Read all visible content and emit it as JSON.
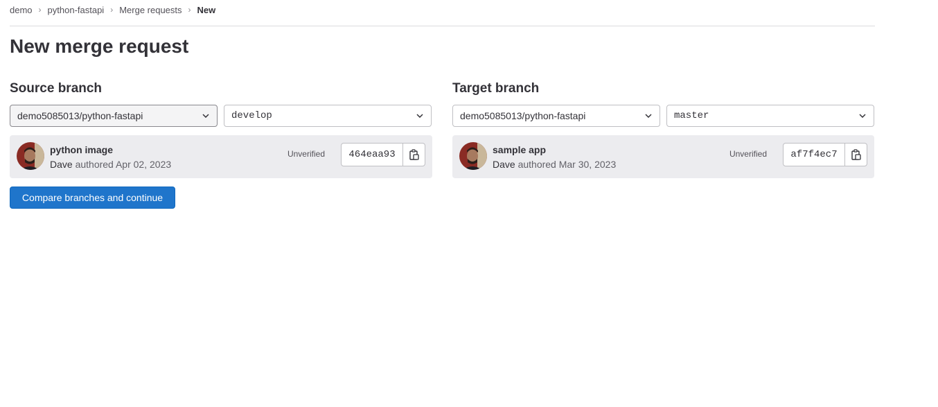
{
  "breadcrumb": [
    {
      "label": "demo"
    },
    {
      "label": "python-fastapi"
    },
    {
      "label": "Merge requests"
    },
    {
      "label": "New"
    }
  ],
  "page_title": "New merge request",
  "source": {
    "heading": "Source branch",
    "project": "demo5085013/python-fastapi",
    "branch": "develop",
    "commit": {
      "title": "python image",
      "author": "Dave",
      "authored_text": "authored Apr 02, 2023",
      "status": "Unverified",
      "sha": "464eaa93"
    }
  },
  "target": {
    "heading": "Target branch",
    "project": "demo5085013/python-fastapi",
    "branch": "master",
    "commit": {
      "title": "sample app",
      "author": "Dave",
      "authored_text": "authored Mar 30, 2023",
      "status": "Unverified",
      "sha": "af7f4ec7"
    }
  },
  "compare_button": "Compare branches and continue",
  "icons": {
    "separator": "chevron-right-icon",
    "dropdown": "chevron-down-icon",
    "copy": "copy-to-clipboard-icon"
  },
  "colors": {
    "primary": "#1f75cb",
    "card_bg": "#ececef",
    "text": "#333238"
  }
}
